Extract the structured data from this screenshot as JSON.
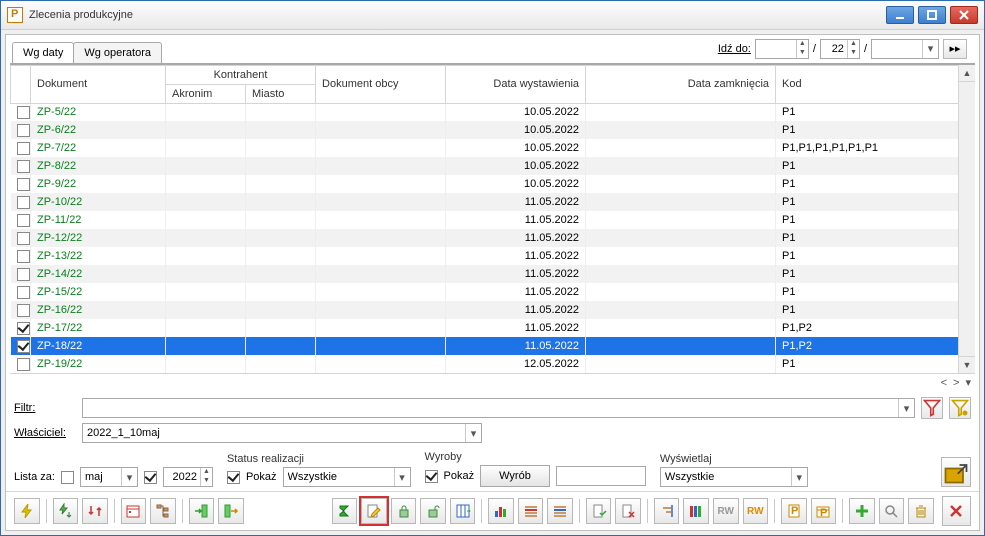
{
  "window": {
    "title": "Zlecenia produkcyjne"
  },
  "tabs": {
    "by_date": "Wg daty",
    "by_operator": "Wg operatora"
  },
  "goto": {
    "label": "Idź do:",
    "val1": "",
    "val2": "22",
    "val3": ""
  },
  "columns": {
    "dokument": "Dokument",
    "kontrahent": "Kontrahent",
    "akronim": "Akronim",
    "miasto": "Miasto",
    "dok_obcy": "Dokument obcy",
    "data_wyst": "Data wystawienia",
    "data_zamk": "Data zamknięcia",
    "kod": "Kod"
  },
  "rows": [
    {
      "chk": false,
      "doc": "ZP-5/22",
      "akr": "",
      "miasto": "",
      "obcy": "",
      "wyst": "10.05.2022",
      "zamk": "",
      "kod": "P1"
    },
    {
      "chk": false,
      "doc": "ZP-6/22",
      "akr": "",
      "miasto": "",
      "obcy": "",
      "wyst": "10.05.2022",
      "zamk": "",
      "kod": "P1"
    },
    {
      "chk": false,
      "doc": "ZP-7/22",
      "akr": "",
      "miasto": "",
      "obcy": "",
      "wyst": "10.05.2022",
      "zamk": "",
      "kod": "P1,P1,P1,P1,P1,P1"
    },
    {
      "chk": false,
      "doc": "ZP-8/22",
      "akr": "",
      "miasto": "",
      "obcy": "",
      "wyst": "10.05.2022",
      "zamk": "",
      "kod": "P1"
    },
    {
      "chk": false,
      "doc": "ZP-9/22",
      "akr": "",
      "miasto": "",
      "obcy": "",
      "wyst": "10.05.2022",
      "zamk": "",
      "kod": "P1"
    },
    {
      "chk": false,
      "doc": "ZP-10/22",
      "akr": "",
      "miasto": "",
      "obcy": "",
      "wyst": "11.05.2022",
      "zamk": "",
      "kod": "P1"
    },
    {
      "chk": false,
      "doc": "ZP-11/22",
      "akr": "",
      "miasto": "",
      "obcy": "",
      "wyst": "11.05.2022",
      "zamk": "",
      "kod": "P1"
    },
    {
      "chk": false,
      "doc": "ZP-12/22",
      "akr": "",
      "miasto": "",
      "obcy": "",
      "wyst": "11.05.2022",
      "zamk": "",
      "kod": "P1"
    },
    {
      "chk": false,
      "doc": "ZP-13/22",
      "akr": "",
      "miasto": "",
      "obcy": "",
      "wyst": "11.05.2022",
      "zamk": "",
      "kod": "P1"
    },
    {
      "chk": false,
      "doc": "ZP-14/22",
      "akr": "",
      "miasto": "",
      "obcy": "",
      "wyst": "11.05.2022",
      "zamk": "",
      "kod": "P1"
    },
    {
      "chk": false,
      "doc": "ZP-15/22",
      "akr": "",
      "miasto": "",
      "obcy": "",
      "wyst": "11.05.2022",
      "zamk": "",
      "kod": "P1"
    },
    {
      "chk": false,
      "doc": "ZP-16/22",
      "akr": "",
      "miasto": "",
      "obcy": "",
      "wyst": "11.05.2022",
      "zamk": "",
      "kod": "P1"
    },
    {
      "chk": true,
      "doc": "ZP-17/22",
      "akr": "",
      "miasto": "",
      "obcy": "",
      "wyst": "11.05.2022",
      "zamk": "",
      "kod": "P1,P2"
    },
    {
      "chk": true,
      "doc": "ZP-18/22",
      "akr": "",
      "miasto": "",
      "obcy": "",
      "wyst": "11.05.2022",
      "zamk": "",
      "kod": "P1,P2",
      "selected": true
    },
    {
      "chk": false,
      "doc": "ZP-19/22",
      "akr": "",
      "miasto": "",
      "obcy": "",
      "wyst": "12.05.2022",
      "zamk": "",
      "kod": "P1"
    }
  ],
  "filters": {
    "filtr_label": "Filtr:",
    "filtr_value": "",
    "wlasciciel_label": "Właściciel:",
    "wlasciciel_value": "2022_1_10maj"
  },
  "bottom": {
    "lista_za": "Lista za:",
    "month": "maj",
    "year": "2022",
    "status_label": "Status realizacji",
    "pokaz": "Pokaż",
    "status_value": "Wszystkie",
    "wyroby_label": "Wyroby",
    "wyrob_btn": "Wyrób",
    "wyrob_value": "",
    "wyswietlaj_label": "Wyświetlaj",
    "wyswietlaj_value": "Wszystkie"
  }
}
